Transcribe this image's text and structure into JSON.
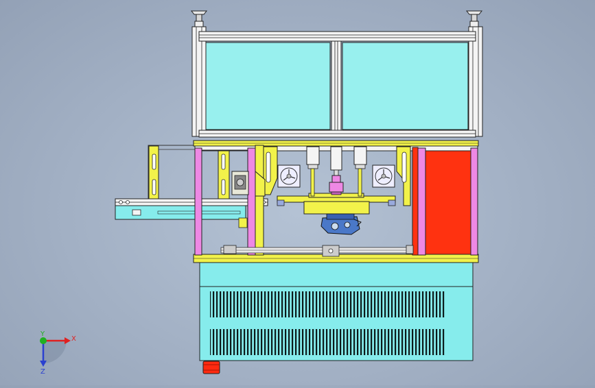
{
  "axis_triad": {
    "x_label": "X",
    "y_label": "Y",
    "z_label": "Z",
    "x_color": "#e02020",
    "y_color": "#20b020",
    "z_color": "#2a40d0"
  },
  "colors": {
    "background": "#a8b6c9",
    "glass": "#98f0ee",
    "frame": "#f4f4f4",
    "rail": "#f2f24a",
    "pink_column": "#ee88e4",
    "red_panel": "#ff3210",
    "cabinet": "#86ecec",
    "outline": "#1a1a1a"
  },
  "icons": [
    "leveling-foot-icon",
    "cooling-fan-icon",
    "emergency-stop-icon",
    "axis-triad-icon"
  ]
}
